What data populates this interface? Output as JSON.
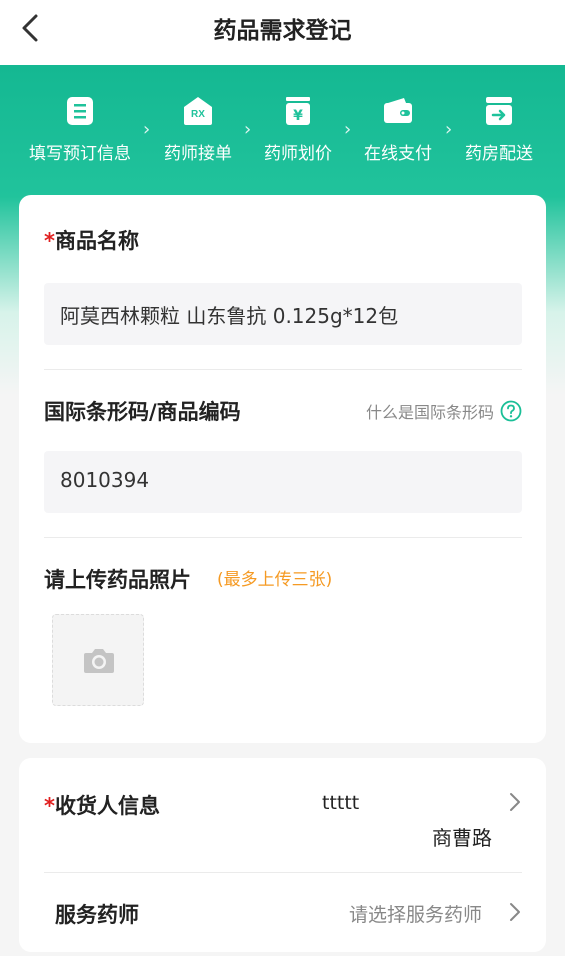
{
  "header": {
    "title": "药品需求登记"
  },
  "steps": [
    {
      "label": "填写预订信息",
      "icon": "list-doc-icon"
    },
    {
      "label": "药师接单",
      "icon": "rx-icon"
    },
    {
      "label": "药师划价",
      "icon": "yen-price-icon"
    },
    {
      "label": "在线支付",
      "icon": "wallet-icon"
    },
    {
      "label": "药房配送",
      "icon": "delivery-box-icon"
    }
  ],
  "product": {
    "required_mark": "*",
    "name_label": "商品名称",
    "name_value": "阿莫西林颗粒  山东鲁抗  0.125g*12包",
    "barcode_label": "国际条形码/商品编码",
    "barcode_help": "什么是国际条形码",
    "barcode_value": "8010394",
    "photo_label": "请上传药品照片",
    "photo_hint": "(最多上传三张)"
  },
  "receiver": {
    "required_mark": "*",
    "label": "收货人信息",
    "name": "ttttt",
    "address": "商曹路"
  },
  "pharmacist": {
    "label": "服务药师",
    "placeholder": "请选择服务药师"
  },
  "colors": {
    "brand_green": "#1abf97",
    "required_red": "#e02020",
    "hint_orange": "#f59a23"
  }
}
